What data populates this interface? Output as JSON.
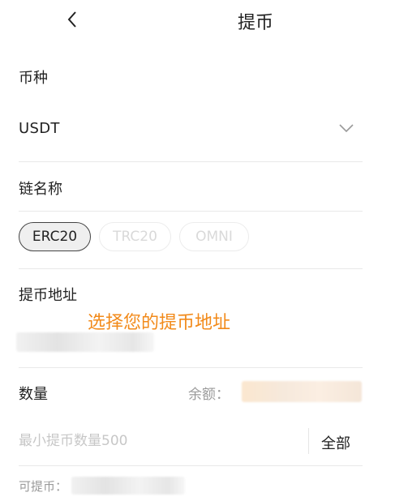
{
  "header": {
    "title": "提币",
    "back_icon": "chevron-left-icon"
  },
  "coin": {
    "label": "币种",
    "value": "USDT",
    "dropdown_icon": "chevron-down-icon"
  },
  "chain": {
    "label": "链名称",
    "options": [
      "ERC20",
      "TRC20",
      "OMNI"
    ],
    "selected": "ERC20"
  },
  "address": {
    "label": "提币地址",
    "hint": "选择您的提币地址"
  },
  "amount": {
    "label": "数量",
    "balance_label": "余额：",
    "placeholder": "最小提币数量500",
    "all_label": "全部"
  },
  "available": {
    "label": "可提币："
  },
  "colors": {
    "accent": "#f28a1a",
    "divider": "#e9e9e9",
    "muted": "#9a9a9a"
  }
}
